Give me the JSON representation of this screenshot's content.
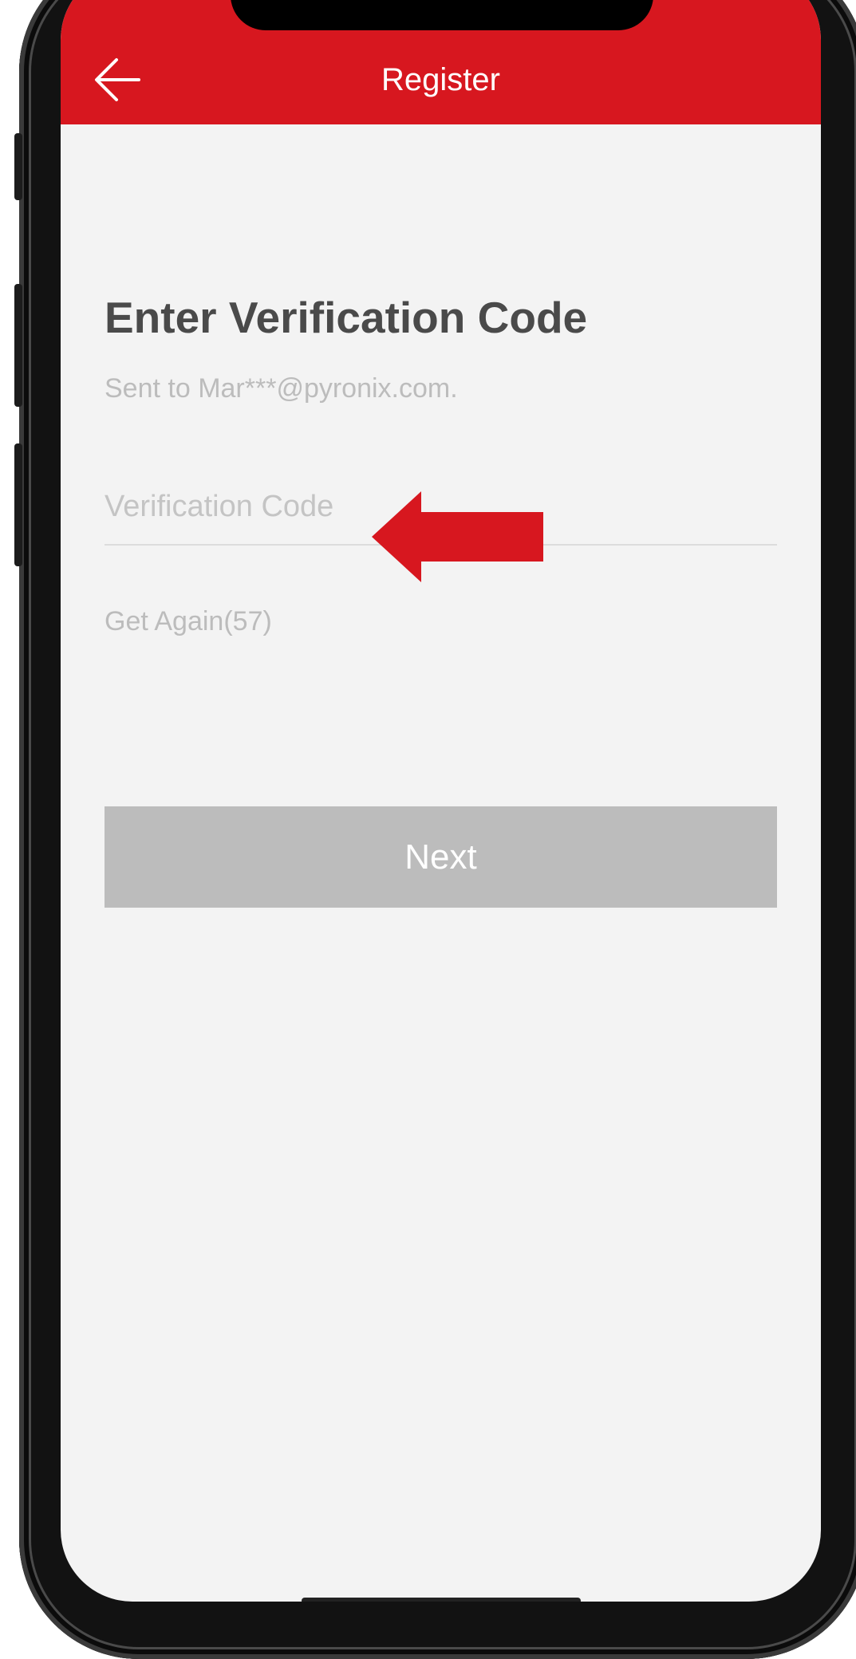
{
  "header": {
    "title": "Register",
    "back_icon": "arrow-left-icon"
  },
  "main": {
    "title": "Enter Verification Code",
    "sent_to": "Sent to Mar***@pyronix.com.",
    "code_input": {
      "placeholder": "Verification Code",
      "value": ""
    },
    "get_again": "Get Again(57)",
    "next_label": "Next"
  },
  "annotation": {
    "arrow_icon": "red-arrow-left-icon",
    "color": "#d7171f"
  },
  "colors": {
    "header_bg": "#d7171f",
    "page_bg": "#f3f3f3",
    "button_disabled": "#bcbcbc",
    "title_text": "#4a4a4a",
    "hint_text": "#bcbcbc"
  }
}
